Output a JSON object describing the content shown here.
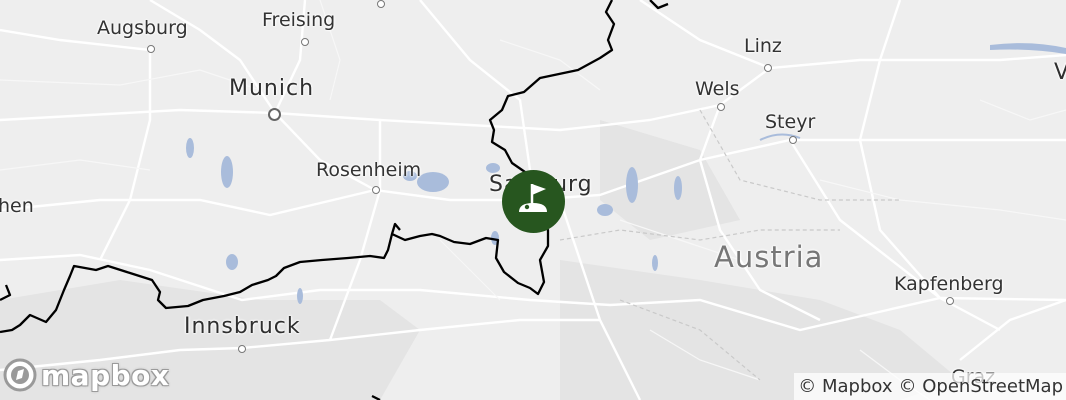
{
  "places": {
    "augsburg": "Augsburg",
    "freising": "Freising",
    "munich": "Munich",
    "linz": "Linz",
    "wels": "Wels",
    "steyr": "Steyr",
    "rosenheim": "Rosenheim",
    "salzburg": "Salzburg",
    "chen": "hen",
    "austria": "Austria",
    "kapfenberg": "Kapfenberg",
    "innsbruck": "Innsbruck",
    "graz": "Graz",
    "edge_v": "V"
  },
  "marker": {
    "icon": "golf-flag-icon",
    "color": "#27561f"
  },
  "logo": {
    "text": "mapbox"
  },
  "attribution": {
    "mapbox": "© Mapbox",
    "osm": "© OpenStreetMap"
  },
  "colors": {
    "land": "#eeeeee",
    "water": "#a9bcdb",
    "border": "#000000",
    "road": "#ffffff"
  }
}
